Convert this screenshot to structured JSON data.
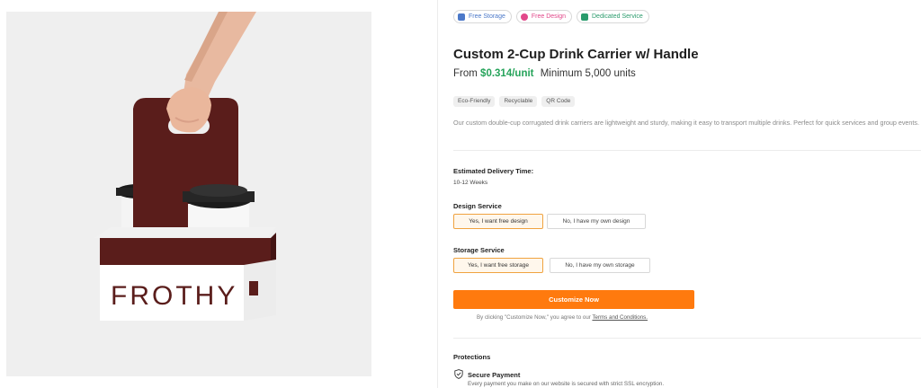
{
  "badges": [
    {
      "label": "Free Storage",
      "icon": "storage-icon",
      "color": "#4c79c9"
    },
    {
      "label": "Free Design",
      "icon": "palette-icon",
      "color": "#e2488a"
    },
    {
      "label": "Dedicated Service",
      "icon": "service-icon",
      "color": "#2a9b6c"
    }
  ],
  "product": {
    "title": "Custom 2-Cup Drink Carrier w/ Handle",
    "price_prefix": "From",
    "price": "$0.314/unit",
    "minimum": "Minimum 5,000 units",
    "tags": [
      "Eco-Friendly",
      "Recyclable",
      "QR Code"
    ],
    "description": "Our custom double-cup corrugated drink carriers are lightweight and sturdy, making it easy to transport multiple drinks. Perfect for quick services and group events.",
    "image_brand_text": "FROTHY"
  },
  "delivery": {
    "label": "Estimated Delivery Time:",
    "value": "10-12 Weeks"
  },
  "design_service": {
    "label": "Design Service",
    "options": [
      "Yes, I want free design",
      "No, I have my own design"
    ],
    "selected": "Yes, I want free design"
  },
  "storage_service": {
    "label": "Storage Service",
    "options": [
      "Yes, I want free storage",
      "No, I have my own storage"
    ],
    "selected": "Yes, I want free storage"
  },
  "cta": {
    "label": "Customize Now",
    "terms_prefix": "By clicking \"Customize Now,\" you agree to our",
    "terms_link": "Terms and Conditions."
  },
  "protections": {
    "title": "Protections",
    "items": [
      {
        "title": "Secure Payment",
        "description": "Every payment you make on our website is secured with strict SSL encryption.",
        "icon": "shield-icon"
      }
    ]
  },
  "colors": {
    "accent": "#ff7a0e",
    "price": "#25a35a",
    "carrier": "#5a1d1b"
  }
}
